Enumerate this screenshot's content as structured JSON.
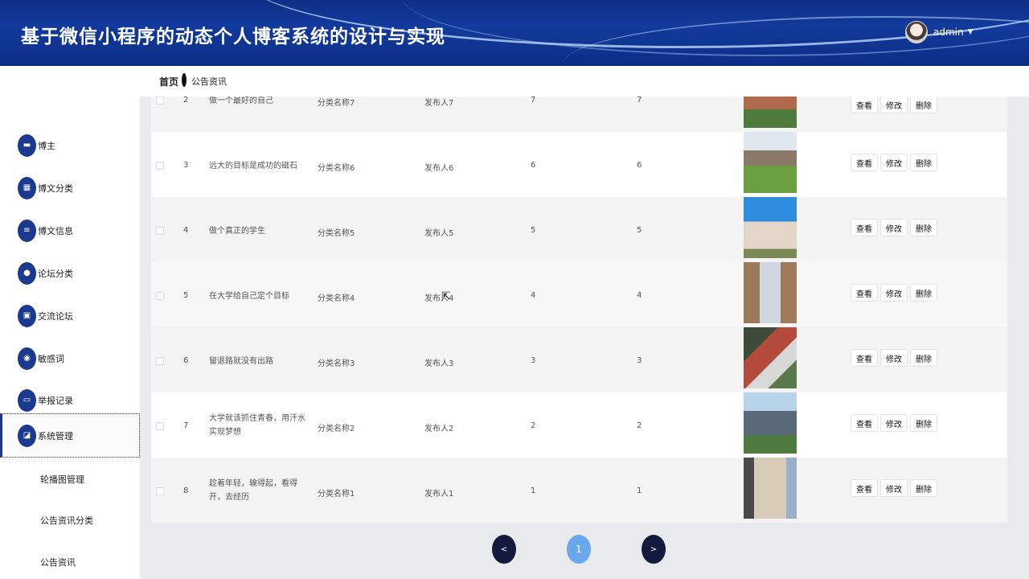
{
  "header": {
    "title": "基于微信小程序的动态个人博客系统的设计与实现",
    "username": "admin"
  },
  "breadcrumb": {
    "home": "首页",
    "current": "公告资讯"
  },
  "sidebar": {
    "items": [
      {
        "label": "博主",
        "icon": "chat-icon"
      },
      {
        "label": "博文分类",
        "icon": "grid-icon"
      },
      {
        "label": "博文信息",
        "icon": "list-icon"
      },
      {
        "label": "论坛分类",
        "icon": "bulb-icon"
      },
      {
        "label": "交流论坛",
        "icon": "clipboard-icon"
      },
      {
        "label": "敏感词",
        "icon": "user-icon"
      },
      {
        "label": "举报记录",
        "icon": "monitor-icon"
      },
      {
        "label": "系统管理",
        "icon": "chart-icon"
      }
    ],
    "subitems": [
      "轮播图管理",
      "公告资讯分类",
      "公告资讯"
    ]
  },
  "table": {
    "rows": [
      {
        "index": "2",
        "title": "做一个最好的自己",
        "category": "分类名称7",
        "publisher": "发布人7",
        "col5": "7",
        "col6": "7"
      },
      {
        "index": "3",
        "title": "远大的目标是成功的磁石",
        "category": "分类名称6",
        "publisher": "发布人6",
        "col5": "6",
        "col6": "6"
      },
      {
        "index": "4",
        "title": "做个真正的学生",
        "category": "分类名称5",
        "publisher": "发布人5",
        "col5": "5",
        "col6": "5"
      },
      {
        "index": "5",
        "title": "在大学给自己定个目标",
        "category": "分类名称4",
        "publisher": "发布人4",
        "col5": "4",
        "col6": "4"
      },
      {
        "index": "6",
        "title": "留退路就没有出路",
        "category": "分类名称3",
        "publisher": "发布人3",
        "col5": "3",
        "col6": "3"
      },
      {
        "index": "7",
        "title": "大学就该抓住青春，用汗水实现梦想",
        "category": "分类名称2",
        "publisher": "发布人2",
        "col5": "2",
        "col6": "2"
      },
      {
        "index": "8",
        "title": "趁着年轻，输得起，看得开，去经历",
        "category": "分类名称1",
        "publisher": "发布人1",
        "col5": "1",
        "col6": "1"
      }
    ],
    "actions": {
      "view": "查看",
      "edit": "修改",
      "delete": "删除"
    }
  },
  "pagination": {
    "prev": "<",
    "current": "1",
    "next": ">"
  }
}
